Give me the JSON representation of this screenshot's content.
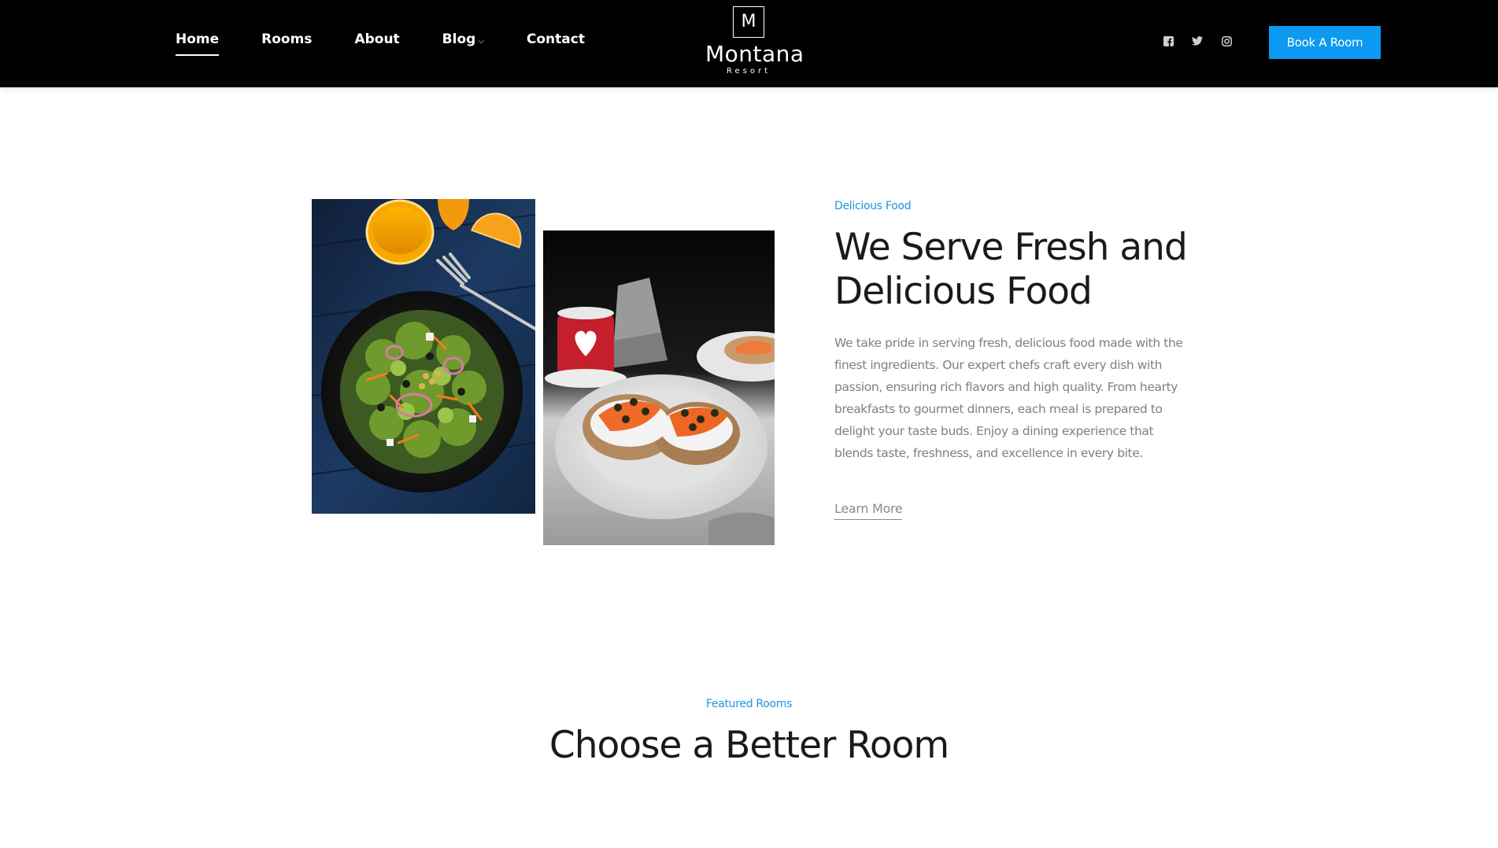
{
  "header": {
    "nav": [
      {
        "label": "Home"
      },
      {
        "label": "Rooms"
      },
      {
        "label": "About"
      },
      {
        "label": "Blog",
        "has_dropdown": true
      },
      {
        "label": "Contact"
      }
    ],
    "logo": {
      "initial": "M",
      "name": "Montana",
      "sub": "Resort"
    },
    "social_icons": [
      "facebook-icon",
      "twitter-icon",
      "instagram-icon"
    ],
    "book_button": "Book A Room",
    "accent_color": "#0c99f0"
  },
  "food_section": {
    "eyebrow": "Delicious Food",
    "title": "We Serve Fresh and Delicious Food",
    "text": "We take pride in serving fresh, delicious food made with the finest ingredients. Our expert chefs craft every dish with passion, ensuring rich flavors and high quality. From hearty breakfasts to gourmet dinners, each meal is prepared to delight your taste buds. Enjoy a dining experience that blends taste, freshness, and excellence in every bite.",
    "link": "Learn More",
    "images": [
      "salad-photo",
      "salmon-toast-photo"
    ]
  },
  "rooms_section": {
    "eyebrow": "Featured Rooms",
    "title": "Choose a Better Room"
  }
}
